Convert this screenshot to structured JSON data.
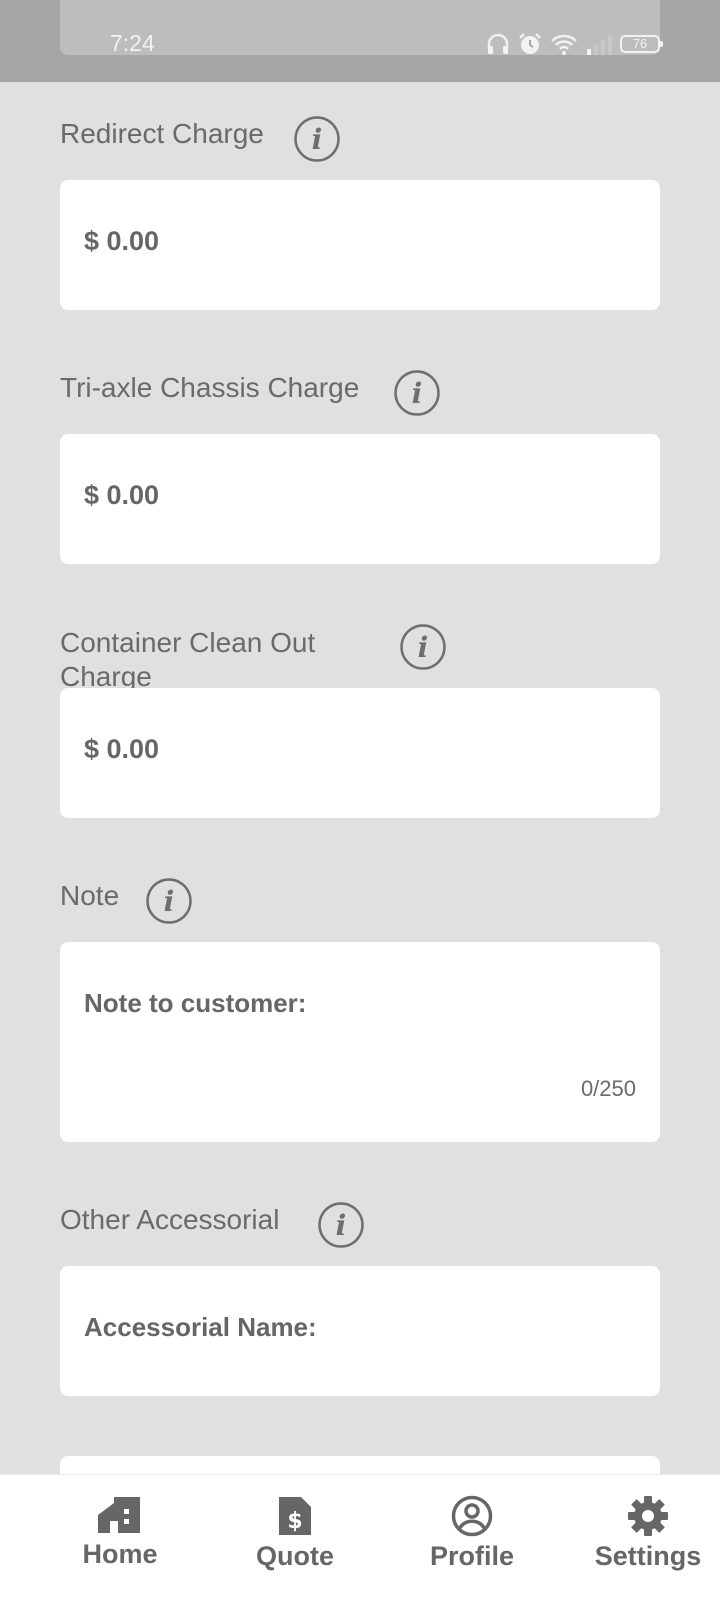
{
  "status_bar": {
    "time": "7:24",
    "battery": "76",
    "icons": [
      "headphones-icon",
      "alarm-icon",
      "wifi-icon",
      "signal-icon",
      "battery-icon"
    ]
  },
  "fields": {
    "redirect": {
      "label": "Redirect Charge",
      "value": "$ 0.00"
    },
    "triaxle": {
      "label": "Tri-axle Chassis Charge",
      "value": "$ 0.00"
    },
    "cleanout": {
      "label": "Container Clean Out Charge",
      "value": "$ 0.00"
    },
    "note": {
      "label": "Note",
      "placeholder": "Note to customer:",
      "counter": "0/250"
    },
    "other": {
      "label": "Other Accessorial",
      "placeholder": "Accessorial Name:"
    }
  },
  "nav": {
    "home": "Home",
    "quote": "Quote",
    "profile": "Profile",
    "settings": "Settings"
  },
  "colors": {
    "page_bg": "#e0e0e0",
    "status_bg": "#a6a6a6",
    "field_bg": "#ffffff",
    "text": "#666666"
  }
}
